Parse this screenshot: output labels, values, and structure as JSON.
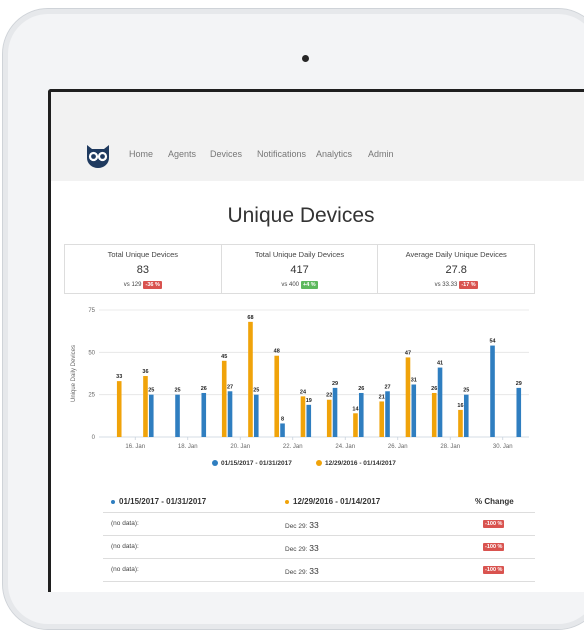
{
  "nav": {
    "items": [
      "Home",
      "Agents",
      "Devices",
      "Notifications",
      "Analytics",
      "Admin"
    ]
  },
  "page_title": "Unique Devices",
  "stats": [
    {
      "label": "Total Unique Devices",
      "value": "83",
      "compare": "vs 129",
      "change": "-36 %",
      "trend": "down"
    },
    {
      "label": "Total Unique Daily Devices",
      "value": "417",
      "compare": "vs 400",
      "change": "+4 %",
      "trend": "up"
    },
    {
      "label": "Average Daily Unique Devices",
      "value": "27.8",
      "compare": "vs 33.33",
      "change": "-17 %",
      "trend": "down"
    }
  ],
  "colors": {
    "current": "#2f7ec0",
    "previous": "#f0a30a",
    "badge_down": "#d9534f",
    "badge_up": "#5cb85c"
  },
  "chart_data": {
    "type": "bar",
    "ylabel": "Unique Daily Devices",
    "ylim": [
      0,
      75
    ],
    "yticks": [
      0,
      25,
      50,
      75
    ],
    "xticks": [
      "16. Jan",
      "18. Jan",
      "20. Jan",
      "22. Jan",
      "24. Jan",
      "26. Jan",
      "28. Jan",
      "30. Jan"
    ],
    "legend_position": "bottom",
    "series": [
      {
        "name": "01/15/2017 - 01/31/2017",
        "color": "#2f7ec0",
        "values": [
          null,
          25,
          25,
          26,
          27,
          25,
          8,
          19,
          29,
          26,
          27,
          31,
          41,
          25,
          54,
          29
        ]
      },
      {
        "name": "12/29/2016 - 01/14/2017",
        "color": "#f0a30a",
        "values": [
          33,
          36,
          null,
          null,
          45,
          68,
          48,
          24,
          22,
          14,
          21,
          47,
          26,
          16,
          null,
          null
        ]
      }
    ]
  },
  "table": {
    "headers": [
      "01/15/2017 - 01/31/2017",
      "12/29/2016 - 01/14/2017",
      "% Change"
    ],
    "rows": [
      {
        "current": "(no data):",
        "prev_date": "Dec 29:",
        "prev_value": "33",
        "change": "-100 %"
      },
      {
        "current": "(no data):",
        "prev_date": "Dec 29:",
        "prev_value": "33",
        "change": "-100 %"
      },
      {
        "current": "(no data):",
        "prev_date": "Dec 29:",
        "prev_value": "33",
        "change": "-100 %"
      }
    ]
  }
}
